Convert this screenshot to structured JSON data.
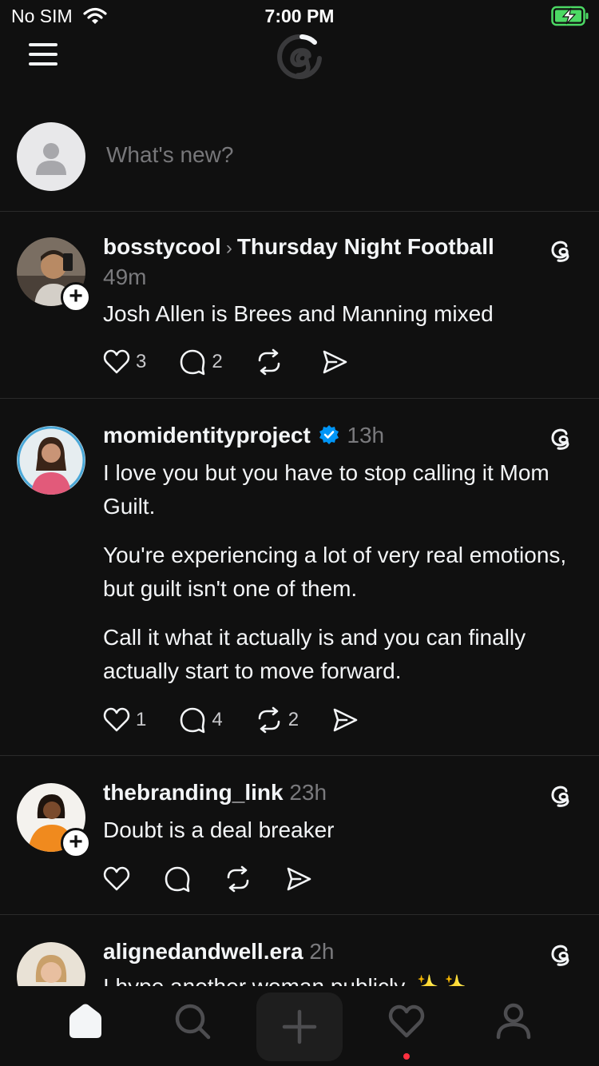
{
  "status": {
    "carrier": "No SIM",
    "time": "7:00 PM"
  },
  "composer": {
    "placeholder": "What's new?"
  },
  "posts": [
    {
      "username": "bosstycool",
      "topic": "Thursday Night Football",
      "time": "49m",
      "paragraphs": [
        "Josh Allen is Brees and Manning mixed"
      ],
      "likes": "3",
      "replies": "2",
      "reposts": ""
    },
    {
      "username": "momidentityproject",
      "verified": true,
      "time": "13h",
      "paragraphs": [
        "I love you but you have to stop calling it Mom Guilt.",
        "You're experiencing a lot of very real emotions, but guilt isn't one of them.",
        "Call it what it actually is and you can finally actually start to move forward."
      ],
      "likes": "1",
      "replies": "4",
      "reposts": "2"
    },
    {
      "username": "thebranding_link",
      "time": "23h",
      "paragraphs": [
        "Doubt is a deal breaker"
      ],
      "likes": "",
      "replies": "",
      "reposts": ""
    },
    {
      "username": "alignedandwell.era",
      "time": "2h",
      "paragraphs": [
        "I hype another woman publicly ✨✨"
      ]
    }
  ],
  "tabs": [
    "home-icon",
    "search-icon",
    "compose-icon",
    "activity-icon",
    "profile-icon"
  ],
  "colors": {
    "background": "#101010",
    "text": "#f3f5f7",
    "muted": "#7a7a7d",
    "verified": "#0095f6",
    "notification": "#ff3040",
    "battery": "#4cd964"
  }
}
